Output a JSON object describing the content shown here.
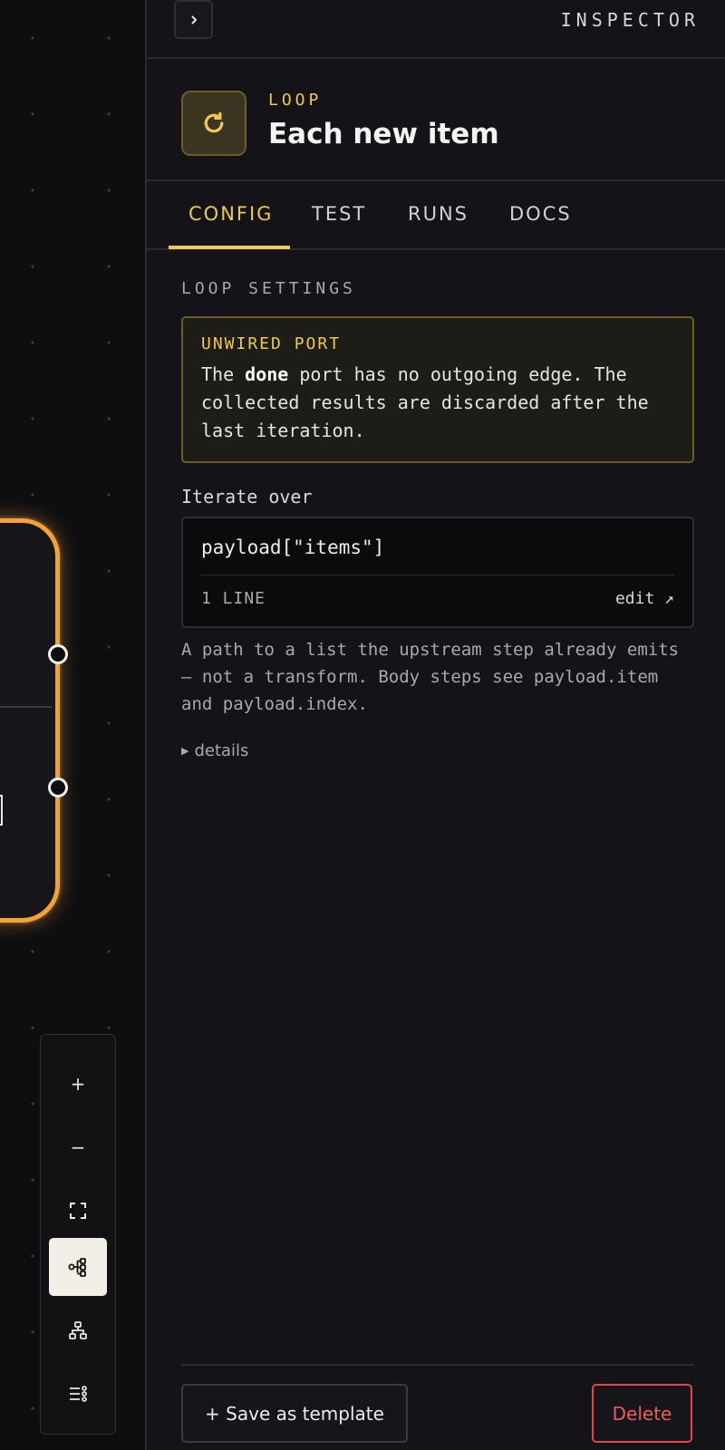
{
  "inspector": {
    "title": "INSPECTOR",
    "collapse_icon": "chevron-right-icon"
  },
  "node": {
    "type": "LOOP",
    "name": "Each new item",
    "icon": "refresh-icon",
    "accent": "#f0c94a"
  },
  "tabs": [
    {
      "label": "CONFIG",
      "active": true
    },
    {
      "label": "TEST",
      "active": false
    },
    {
      "label": "RUNS",
      "active": false
    },
    {
      "label": "DOCS",
      "active": false
    }
  ],
  "settings": {
    "section_label": "LOOP SETTINGS",
    "warning": {
      "title": "UNWIRED PORT",
      "text_before": "The ",
      "port_name": "done",
      "text_after": " port has no outgoing edge. The collected results are discarded after the last iteration."
    },
    "iterate": {
      "label": "Iterate over",
      "value": "payload[\"items\"]",
      "line_count": "1 LINE",
      "edit_label": "edit ↗"
    },
    "help": "A path to a list the upstream step already emits — not a transform. Body steps see payload.item and payload.index.",
    "details_label": "details"
  },
  "footer": {
    "save_template_label": "+ Save as template",
    "delete_label": "Delete",
    "delete_color": "#ef5a62"
  },
  "canvas": {
    "selected_node_border": "#f3a23a",
    "toolbar": [
      {
        "name": "zoom-in",
        "glyph": "+"
      },
      {
        "name": "zoom-out",
        "glyph": "−"
      },
      {
        "name": "fit-view",
        "glyph": ""
      },
      {
        "name": "layout-horizontal",
        "glyph": "",
        "active": true
      },
      {
        "name": "layout-tree",
        "glyph": ""
      },
      {
        "name": "list-settings",
        "glyph": ""
      }
    ]
  }
}
